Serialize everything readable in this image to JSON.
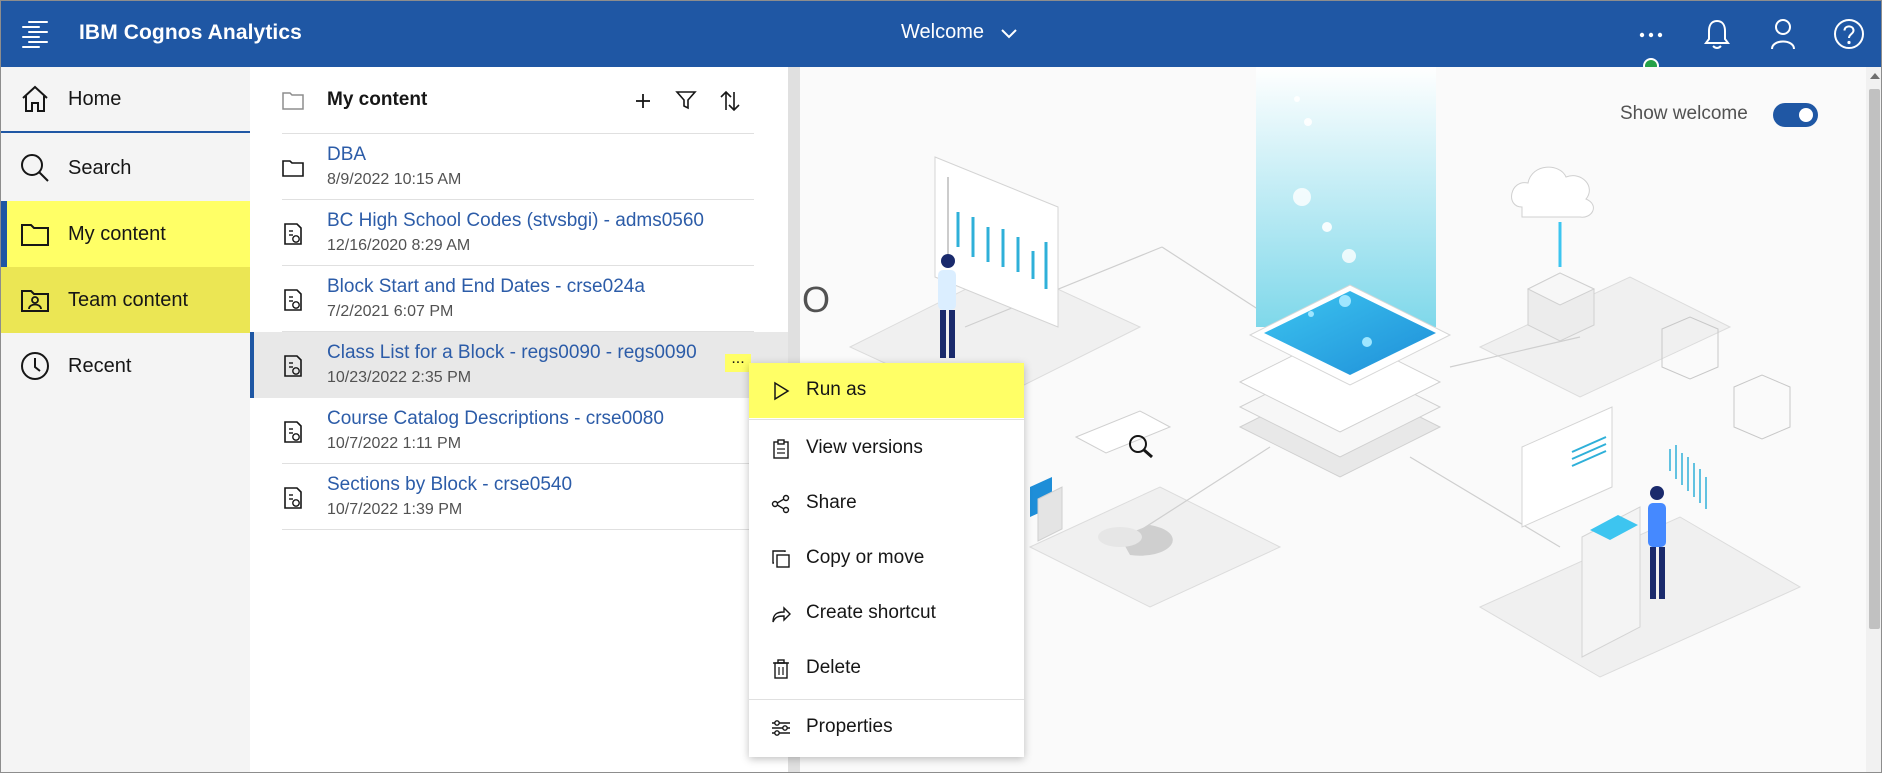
{
  "app": {
    "title": "IBM Cognos Analytics",
    "context_label": "Welcome"
  },
  "topbar": {
    "icons": [
      "menu-icon",
      "chevron-down-icon",
      "more-icon",
      "bell-icon",
      "user-icon",
      "help-icon"
    ],
    "status_color": "#24a148",
    "bg_color": "#1f57a4"
  },
  "nav": {
    "items": [
      {
        "label": "Home",
        "icon": "home-icon"
      },
      {
        "label": "Search",
        "icon": "search-icon"
      },
      {
        "label": "My content",
        "icon": "folder-icon",
        "highlighted": true,
        "selected": true
      },
      {
        "label": "Team content",
        "icon": "team-folder-icon",
        "highlighted": true
      },
      {
        "label": "Recent",
        "icon": "clock-icon"
      }
    ]
  },
  "panel": {
    "title": "My content",
    "actions": [
      "add-icon",
      "filter-icon",
      "sort-icon"
    ],
    "rows": [
      {
        "title": "DBA",
        "suffix": "",
        "date": "8/9/2022 10:15 AM",
        "type": "folder"
      },
      {
        "title": "BC High School Codes (stvsbgi)",
        "suffix": " - adms0560",
        "date": "12/16/2020 8:29 AM",
        "type": "report"
      },
      {
        "title": "Block Start and End Dates",
        "suffix": " - crse024a",
        "date": "7/2/2021 6:07 PM",
        "type": "report"
      },
      {
        "title": "Class List for a Block",
        "suffix": " - regs0090 - regs0090",
        "date": "10/23/2022 2:35 PM",
        "type": "report",
        "selected": true
      },
      {
        "title": "Course Catalog Descriptions",
        "suffix": " - crse0080",
        "date": "10/7/2022 1:11 PM",
        "type": "report"
      },
      {
        "title": "Sections by Block",
        "suffix": " - crse0540",
        "date": "10/7/2022 1:39 PM",
        "type": "report"
      }
    ],
    "row_more_label": "..."
  },
  "welcome": {
    "show_welcome_label": "Show welcome",
    "show_welcome_on": true,
    "partial_text": "O"
  },
  "context_menu": {
    "items": [
      {
        "label": "Run as",
        "icon": "play-icon",
        "highlighted": true
      },
      {
        "label": "View versions",
        "icon": "clipboard-icon"
      },
      {
        "label": "Share",
        "icon": "share-icon"
      },
      {
        "label": "Copy or move",
        "icon": "copy-icon"
      },
      {
        "label": "Create shortcut",
        "icon": "shortcut-icon"
      },
      {
        "label": "Delete",
        "icon": "trash-icon"
      },
      {
        "label": "Properties",
        "icon": "sliders-icon"
      }
    ],
    "highlight_color": "#ffff66"
  }
}
